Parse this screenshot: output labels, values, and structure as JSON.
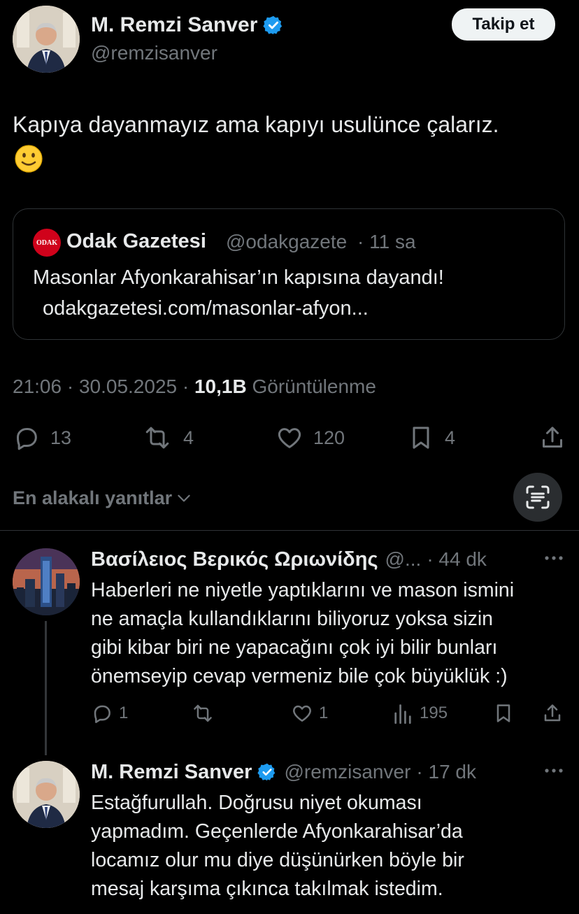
{
  "tweet": {
    "author_name": "M. Remzi Sanver",
    "author_handle": "@remzisanver",
    "follow_label": "Takip et",
    "text": "Kapıya dayanmayız ama kapıyı usulünce çalarız.",
    "emoji": "🙂",
    "quote": {
      "logo_text": "ODAK",
      "name": "Odak Gazetesi",
      "handle": "@odakgazete",
      "time": "· 11 sa",
      "text": "Masonlar Afyonkarahisar’ın kapısına dayandı!",
      "link": "odakgazetesi.com/masonlar-afyon..."
    },
    "timestamp": "21:06 · 30.05.2025 ·",
    "views_count": "10,1B",
    "views_label": "Görüntülenme",
    "stats": {
      "replies": "13",
      "retweets": "4",
      "likes": "120",
      "bookmarks": "4"
    }
  },
  "replies_header": {
    "sort_label": "En alakalı yanıtlar"
  },
  "replies": [
    {
      "author_name": "Βασίλειος Βερικός Ωριωνίδης",
      "author_handle": "@...",
      "time": "· 44 dk",
      "lines": [
        "Haberleri ne niyetle yaptıklarını ve mason ismini",
        "ne amaçla kullandıklarını biliyoruz yoksa sizin",
        "gibi kibar biri ne yapacağını çok iyi bilir bunları",
        "önemseyip cevap vermeniz bile çok büyüklük :)"
      ],
      "stats": {
        "replies": "1",
        "likes": "1",
        "views": "195"
      }
    },
    {
      "author_name": "M. Remzi Sanver",
      "author_handle": "@remzisanver",
      "time": "· 17 dk",
      "lines": [
        "Estağfurullah. Doğrusu niyet okuması",
        "yapmadım. Geçenlerde Afyonkarahisar’da",
        "locamız olur mu diye düşünürken böyle bir",
        "mesaj karşıma çıkınca takılmak istedim."
      ]
    }
  ],
  "colors": {
    "background": "#000000",
    "text": "#e7e9ea",
    "muted": "#71767b",
    "verified": "#1d9bf0",
    "border": "#2f3336"
  }
}
